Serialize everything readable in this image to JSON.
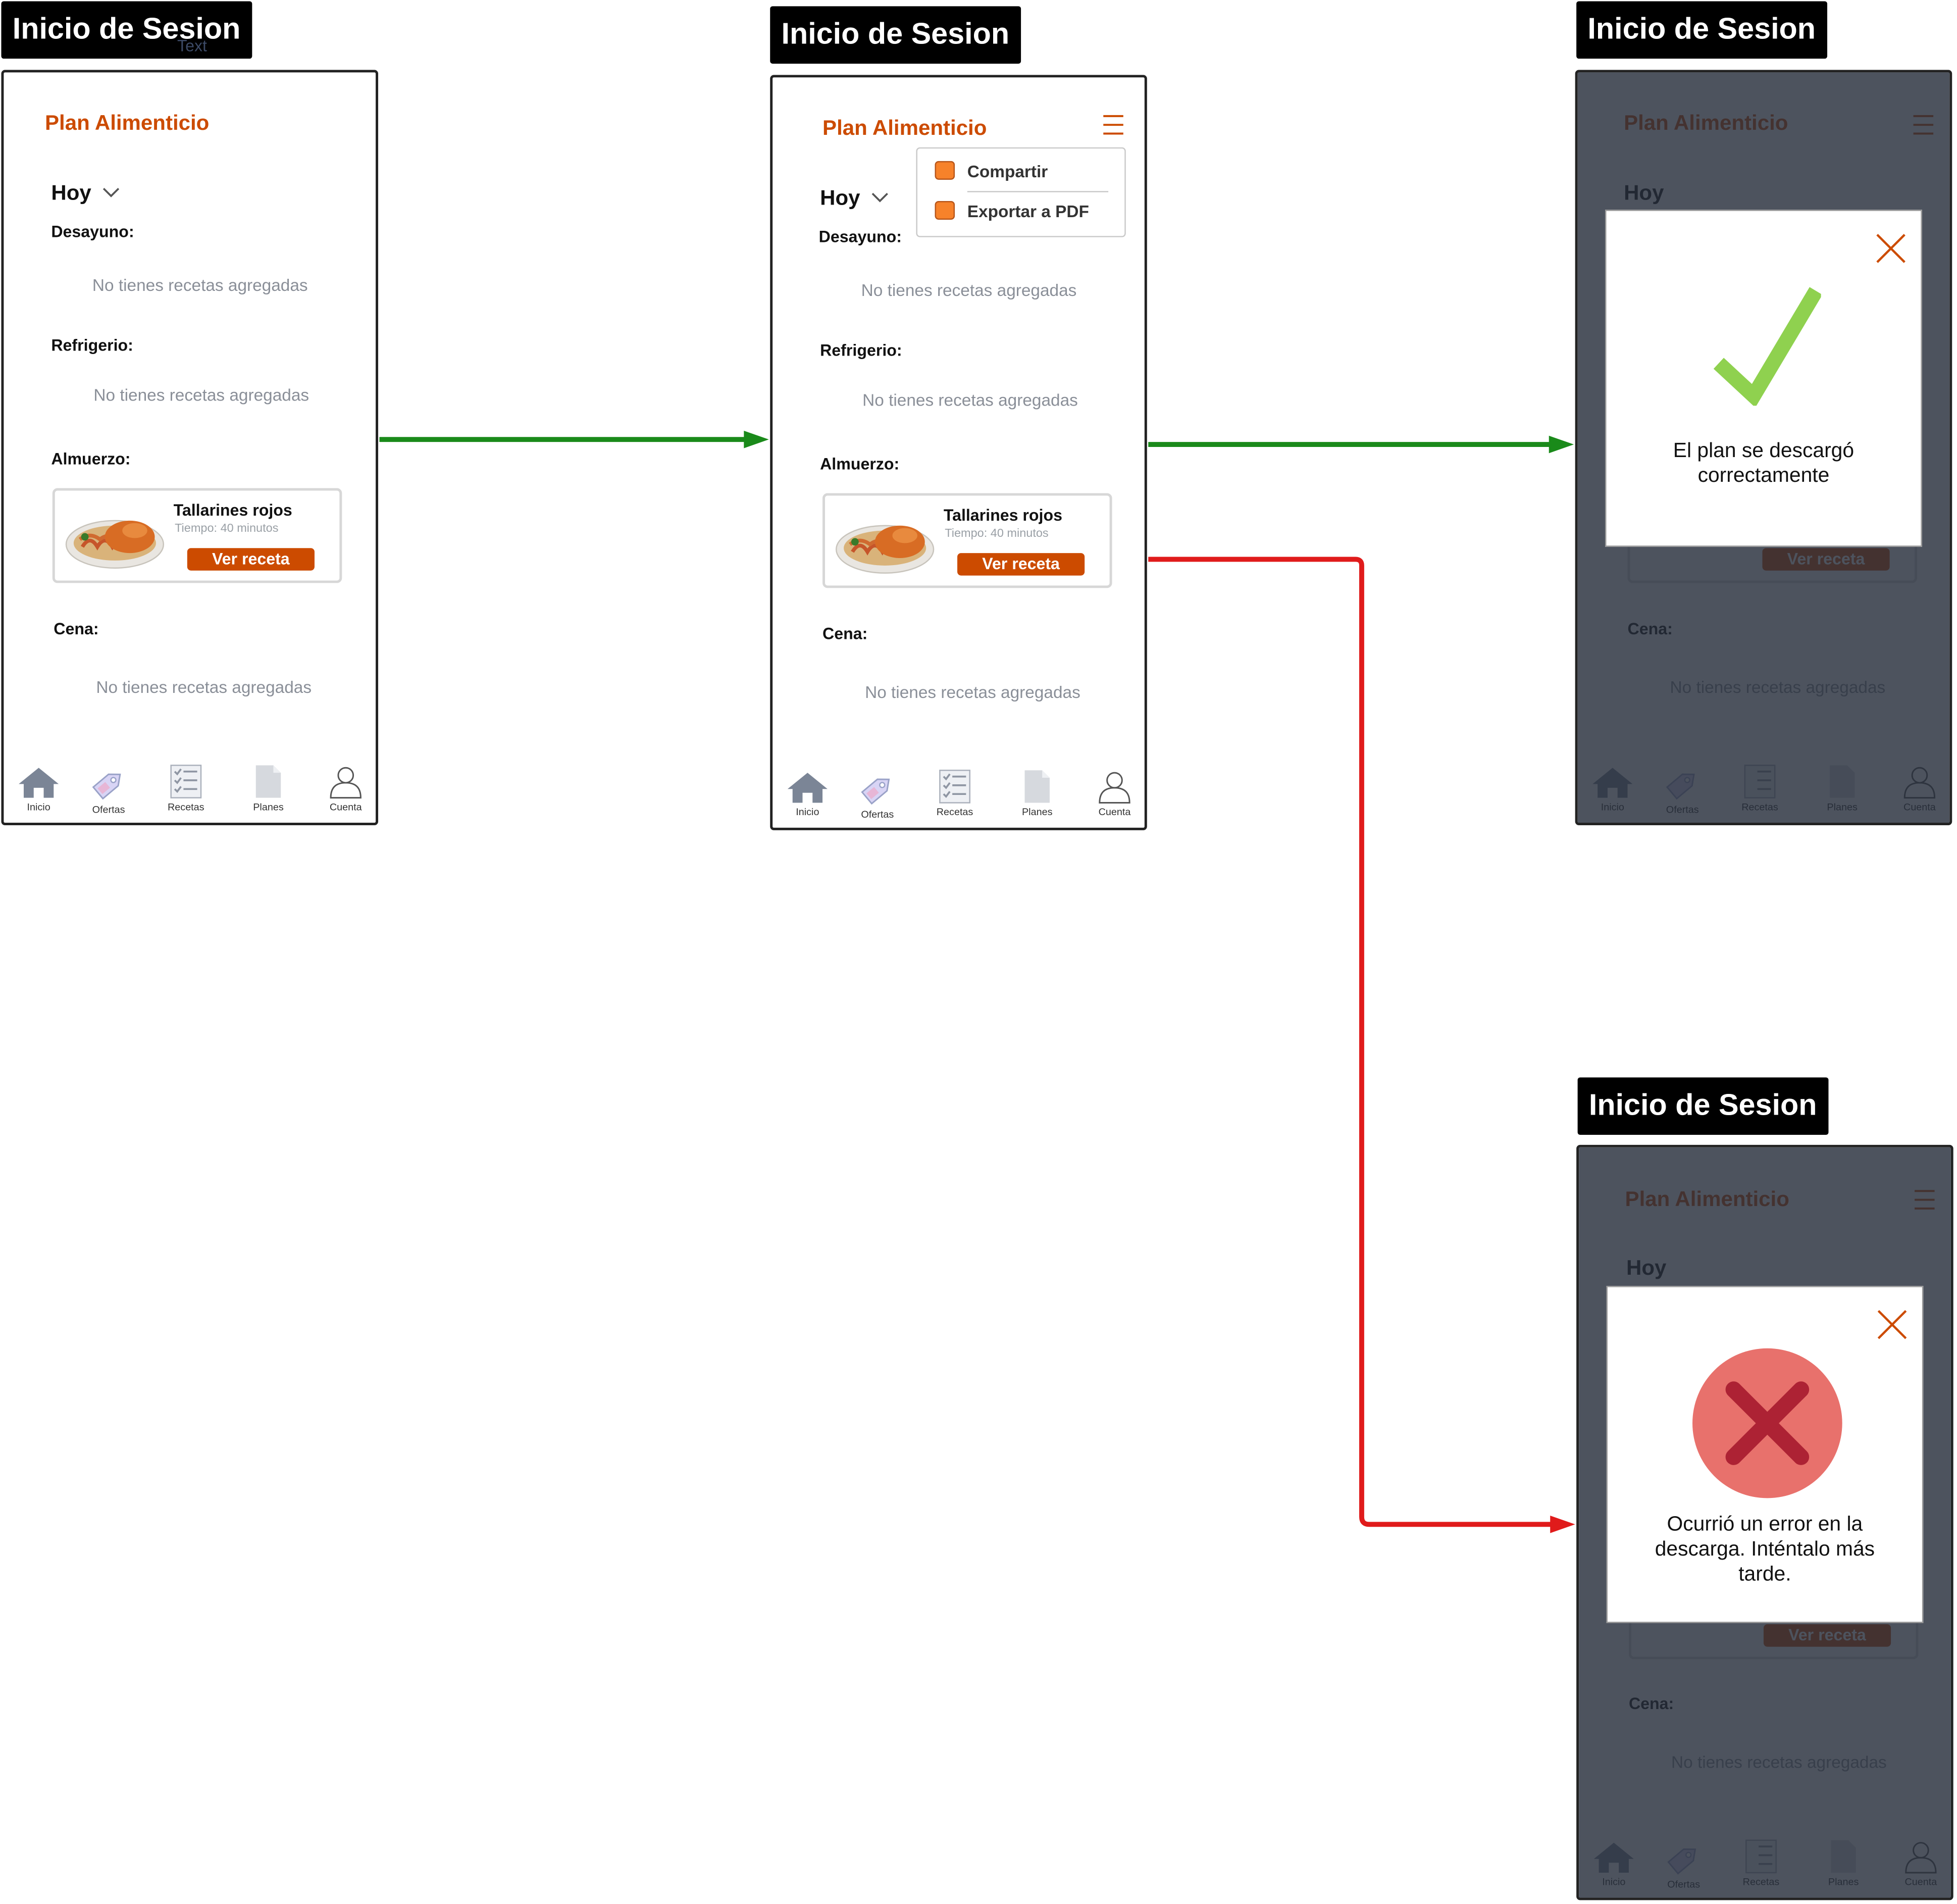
{
  "screen_title": "Inicio de Sesion",
  "ghost_label": "Text",
  "app": {
    "title": "Plan Alimenticio",
    "day": "Hoy",
    "meals": {
      "breakfast": "Desayuno:",
      "snack": "Refrigerio:",
      "lunch": "Almuerzo:",
      "dinner": "Cena:"
    },
    "empty_text": "No tienes recetas agregadas",
    "recipe": {
      "name": "Tallarines rojos",
      "time": "Tiempo: 40 minutos",
      "button": "Ver receta"
    },
    "nav": [
      "Inicio",
      "Ofertas",
      "Recetas",
      "Planes",
      "Cuenta"
    ]
  },
  "menu": {
    "share": "Compartir",
    "export": "Exportar a PDF"
  },
  "success_modal": {
    "message": "El plan se descargó correctamente"
  },
  "error_modal": {
    "message": "Ocurrió un error en la descarga. Inténtalo más tarde."
  },
  "colors": {
    "brand_orange": "#cc4b00",
    "success_arrow": "#1a8a1a",
    "error_arrow": "#e01b1b",
    "check_green": "#8fd14f",
    "error_circle": "#e8716c",
    "error_cross": "#ad2234",
    "overlay": "#262d3a"
  },
  "icons": {
    "nav": [
      "home-icon",
      "tag-icon",
      "checklist-icon",
      "document-icon",
      "user-icon"
    ],
    "menu": "hamburger-icon",
    "close": "close-icon",
    "success": "checkmark-icon",
    "error": "error-x-icon"
  }
}
